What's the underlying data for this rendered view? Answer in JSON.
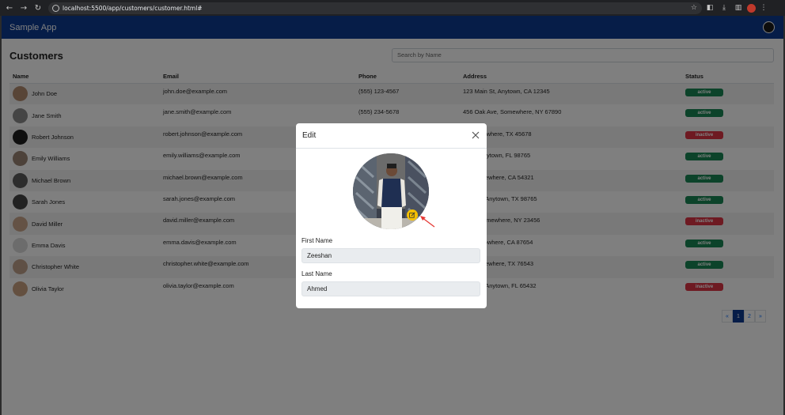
{
  "browser": {
    "url": "localhost:5500/app/customers/customer.html#",
    "back_icon": "back-arrow-icon",
    "forward_icon": "forward-arrow-icon",
    "reload_icon": "reload-icon"
  },
  "app": {
    "brand": "Sample App"
  },
  "page": {
    "title": "Customers",
    "search_placeholder": "Search by Name"
  },
  "table": {
    "headers": {
      "name": "Name",
      "email": "Email",
      "phone": "Phone",
      "address": "Address",
      "status": "Status"
    },
    "rows": [
      {
        "name": "John Doe",
        "email": "john.doe@example.com",
        "phone": "(555) 123-4567",
        "address": "123 Main St, Anytown, CA 12345",
        "status": "active"
      },
      {
        "name": "Jane Smith",
        "email": "jane.smith@example.com",
        "phone": "(555) 234-5678",
        "address": "456 Oak Ave, Somewhere, NY 67890",
        "status": "active"
      },
      {
        "name": "Robert Johnson",
        "email": "robert.johnson@example.com",
        "phone": "",
        "address": "e Rd, Nowhere, TX 45678",
        "status": "inactive"
      },
      {
        "name": "Emily Williams",
        "email": "emily.williams@example.com",
        "phone": "",
        "address": "ar Ln, Anytown, FL 98765",
        "status": "active"
      },
      {
        "name": "Michael Brown",
        "email": "michael.brown@example.com",
        "phone": "",
        "address": "h St, Elsewhere, CA 54321",
        "status": "active"
      },
      {
        "name": "Sarah Jones",
        "email": "sarah.jones@example.com",
        "phone": "",
        "address": "ple Ave, Anytown, TX 98765",
        "status": "active"
      },
      {
        "name": "David Miller",
        "email": "david.miller@example.com",
        "phone": "",
        "address": "e Rd, Somewhere, NY 23456",
        "status": "inactive"
      },
      {
        "name": "Emma Davis",
        "email": "emma.davis@example.com",
        "phone": "",
        "address": "ar Ln, Nowhere, CA 87654",
        "status": "active"
      },
      {
        "name": "Christopher White",
        "email": "christopher.white@example.com",
        "phone": "",
        "address": "h St, Elsewhere, TX 76543",
        "status": "active"
      },
      {
        "name": "Olivia Taylor",
        "email": "olivia.taylor@example.com",
        "phone": "",
        "address": "ple Ave, Anytown, FL 65432",
        "status": "inactive"
      }
    ]
  },
  "pagination": {
    "prev": "«",
    "page1": "1",
    "page2": "2",
    "next": "»"
  },
  "modal": {
    "title": "Edit",
    "first_name_label": "First Name",
    "first_name_value": "Zeeshan",
    "last_name_label": "Last Name",
    "last_name_value": "Ahmed"
  },
  "colors": {
    "navbar": "#0d3b91",
    "active": "#198754",
    "inactive": "#dc3545",
    "edit_button": "#f5c000"
  }
}
